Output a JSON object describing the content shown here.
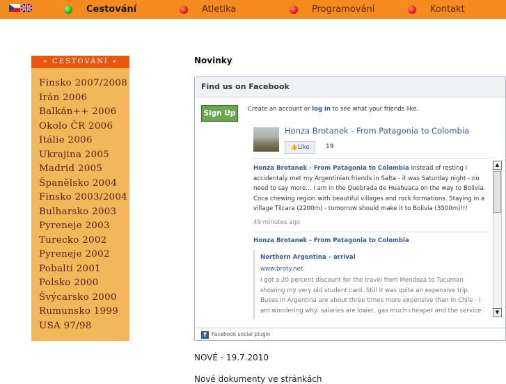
{
  "topbar": {
    "bg_color": "#f58a1f",
    "flags": [
      {
        "name": "czech-flag"
      },
      {
        "name": "uk-flag"
      }
    ],
    "nav": [
      {
        "label": "Cestování",
        "status": "green",
        "active": true
      },
      {
        "label": "Atletika",
        "status": "red",
        "active": false
      },
      {
        "label": "Programování",
        "status": "red",
        "active": false
      },
      {
        "label": "Kontakt",
        "status": "red",
        "active": false
      }
    ]
  },
  "sidebar": {
    "heading": "» CESTOVÁNÍ «",
    "heading_color": "#e8570b",
    "bg_color": "#f2b75a",
    "items": [
      "Finsko 2007/2008",
      "Irán 2006",
      "Balkán++ 2006",
      "Okolo ČR 2006",
      "Itálie 2006",
      "Ukrajina 2005",
      "Madrid 2005",
      "Španělsko 2004",
      "Finsko 2003/2004",
      "Bulharsko 2003",
      "Pyreneje 2003",
      "Turecko 2002",
      "Pyreneje 2002",
      "Pobaltí 2001",
      "Polsko 2000",
      "Švýcarsko 2000",
      "Rumunsko 1999",
      "USA 97/98"
    ]
  },
  "main": {
    "title": "Novinky",
    "news_date": "NOVÉ - 19.7.2010",
    "news_line": "Nové dokumenty ve stránkách"
  },
  "facebook": {
    "header": "Find us on Facebook",
    "signup_label": "Sign Up",
    "create_prefix": "Create an account or ",
    "login_label": "log in",
    "create_suffix": " to see what your friends like.",
    "page_name": "Honza Brotanek - From Patagonia to Colombia",
    "like_label": "Like",
    "like_count": "19",
    "post1_author": "Honza Brotanek - From Patagonia to Colombia",
    "post1_text": " Instead of resting I accidentaly met my Argentinian friends in Salta - it was Saturday night - no need to say more... I am in the Quebrada de Huahuaca on the way to Bolivia. Coca chewing region with beautiful villages and rock formations. Staying in a village Tilcara (2200m) - tomorrow should make it to Bolivia (3500m)!!!",
    "post1_time": "49 minutes ago",
    "post2_author": "Honza Brotanek - From Patagonia to Colombia",
    "attach_title": "Northern Argentina – arrival",
    "attach_url": "www.broty.net",
    "attach_text": "I got a 20 percent discount for the travel from Mendoza to Tucuman showing my very old student card. Still it was quite an expensive trip. Buses in Argentina are about three times more expensive than in Chile - I am wondering why: salaries are lower, gas much cheaper and the service",
    "footer": "Facebook social plugin"
  }
}
